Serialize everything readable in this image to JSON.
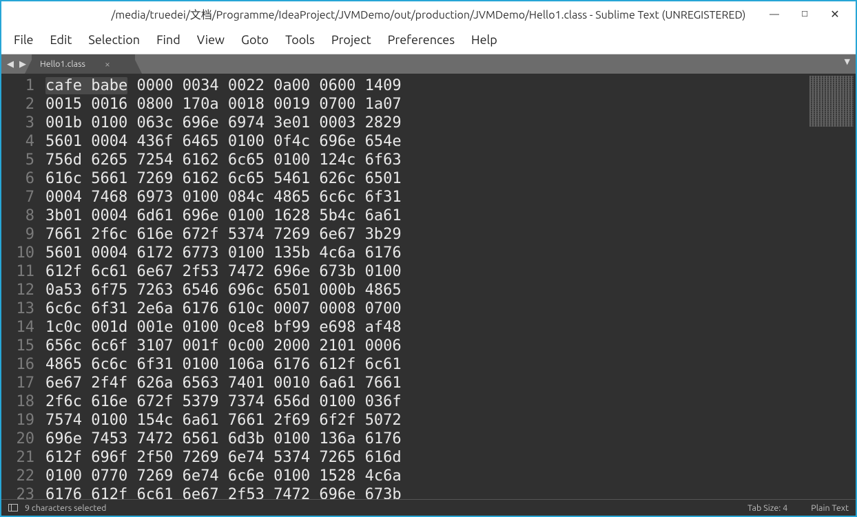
{
  "window": {
    "title": "/media/truedei/文档/Programme/IdeaProject/JVMDemo/out/production/JVMDemo/Hello1.class - Sublime Text (UNREGISTERED)"
  },
  "menu": {
    "items": [
      "File",
      "Edit",
      "Selection",
      "Find",
      "View",
      "Goto",
      "Tools",
      "Project",
      "Preferences",
      "Help"
    ]
  },
  "tabs": {
    "active": {
      "label": "Hello1.class"
    }
  },
  "status": {
    "selection": "9 characters selected",
    "tab_size": "Tab Size: 4",
    "syntax": "Plain Text"
  },
  "editor": {
    "selection_prefix": "cafe babe",
    "lines": [
      "cafe babe 0000 0034 0022 0a00 0600 1409",
      "0015 0016 0800 170a 0018 0019 0700 1a07",
      "001b 0100 063c 696e 6974 3e01 0003 2829",
      "5601 0004 436f 6465 0100 0f4c 696e 654e",
      "756d 6265 7254 6162 6c65 0100 124c 6f63",
      "616c 5661 7269 6162 6c65 5461 626c 6501",
      "0004 7468 6973 0100 084c 4865 6c6c 6f31",
      "3b01 0004 6d61 696e 0100 1628 5b4c 6a61",
      "7661 2f6c 616e 672f 5374 7269 6e67 3b29",
      "5601 0004 6172 6773 0100 135b 4c6a 6176",
      "612f 6c61 6e67 2f53 7472 696e 673b 0100",
      "0a53 6f75 7263 6546 696c 6501 000b 4865",
      "6c6c 6f31 2e6a 6176 610c 0007 0008 0700",
      "1c0c 001d 001e 0100 0ce8 bf99 e698 af48",
      "656c 6c6f 3107 001f 0c00 2000 2101 0006",
      "4865 6c6c 6f31 0100 106a 6176 612f 6c61",
      "6e67 2f4f 626a 6563 7401 0010 6a61 7661",
      "2f6c 616e 672f 5379 7374 656d 0100 036f",
      "7574 0100 154c 6a61 7661 2f69 6f2f 5072",
      "696e 7453 7472 6561 6d3b 0100 136a 6176",
      "612f 696f 2f50 7269 6e74 5374 7265 616d",
      "0100 0770 7269 6e74 6c6e 0100 1528 4c6a",
      "6176 612f 6c61 6e67 2f53 7472 696e 673b"
    ]
  }
}
